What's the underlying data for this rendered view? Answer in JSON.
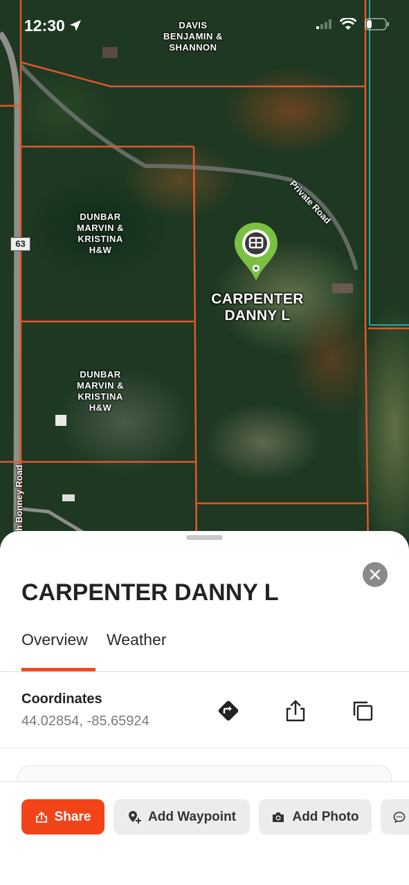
{
  "status_bar": {
    "time": "12:30"
  },
  "map": {
    "parcels": [
      {
        "id": "davis",
        "lines": [
          "DAVIS",
          "BENJAMIN &",
          "SHANNON"
        ]
      },
      {
        "id": "dunbar-north",
        "lines": [
          "DUNBAR",
          "MARVIN &",
          "KRISTINA",
          "H&W"
        ]
      },
      {
        "id": "dunbar-south",
        "lines": [
          "DUNBAR",
          "MARVIN &",
          "KRISTINA",
          "H&W"
        ]
      }
    ],
    "roads": {
      "private": "Private Road",
      "bonney": "th Bonney Road",
      "route_number": "63"
    },
    "selected_pin": {
      "label_line1": "CARPENTER",
      "label_line2": "DANNY L",
      "color": "#7ac142"
    },
    "boundary_color": "#e0582c"
  },
  "sheet": {
    "title": "CARPENTER DANNY L",
    "tabs": [
      {
        "label": "Overview",
        "active": true
      },
      {
        "label": "Weather",
        "active": false
      }
    ],
    "coordinates": {
      "label": "Coordinates",
      "value": "44.02854, -85.65924"
    },
    "actions": [
      "directions-icon",
      "share-icon",
      "copy-icon"
    ],
    "buttons": {
      "share": "Share",
      "add_waypoint": "Add Waypoint",
      "add_photo": "Add Photo"
    },
    "accent_color": "#f24419"
  }
}
